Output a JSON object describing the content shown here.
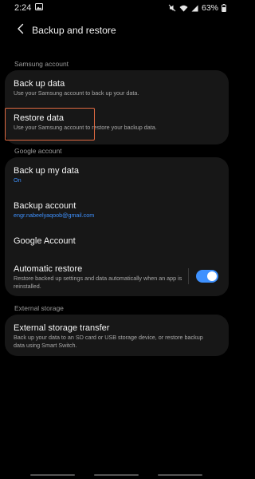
{
  "status_bar": {
    "time": "2:24",
    "battery_percent": "63%",
    "icons": [
      "image-icon",
      "mute-icon",
      "wifi-icon",
      "signal-icon",
      "battery-icon"
    ]
  },
  "header": {
    "back_icon": "chevron-left-icon",
    "title": "Backup and restore"
  },
  "sections": {
    "samsung": {
      "label": "Samsung account",
      "items": [
        {
          "title": "Back up data",
          "subtitle": "Use your Samsung account to back up your data."
        },
        {
          "title": "Restore data",
          "subtitle": "Use your Samsung account to restore your backup data."
        }
      ]
    },
    "google": {
      "label": "Google account",
      "items": [
        {
          "title": "Back up my data",
          "subtitle": "On"
        },
        {
          "title": "Backup account",
          "subtitle": "engr.nabeelyaqoob@gmail.com"
        },
        {
          "title": "Google Account"
        },
        {
          "title": "Automatic restore",
          "subtitle_line1": "Restore backed up settings and data automatically when an app is",
          "subtitle_line2": "reinstalled.",
          "toggle_on": true
        }
      ]
    },
    "external": {
      "label": "External storage",
      "items": [
        {
          "title": "External storage transfer",
          "subtitle_line1": "Back up your data to an SD card or USB storage device, or restore backup",
          "subtitle_line2": "data using Smart Switch."
        }
      ]
    }
  },
  "colors": {
    "background": "#000000",
    "card": "#171717",
    "accent": "#3e91ff",
    "highlight": "#e06a42",
    "section_label": "#9a9a9a"
  }
}
